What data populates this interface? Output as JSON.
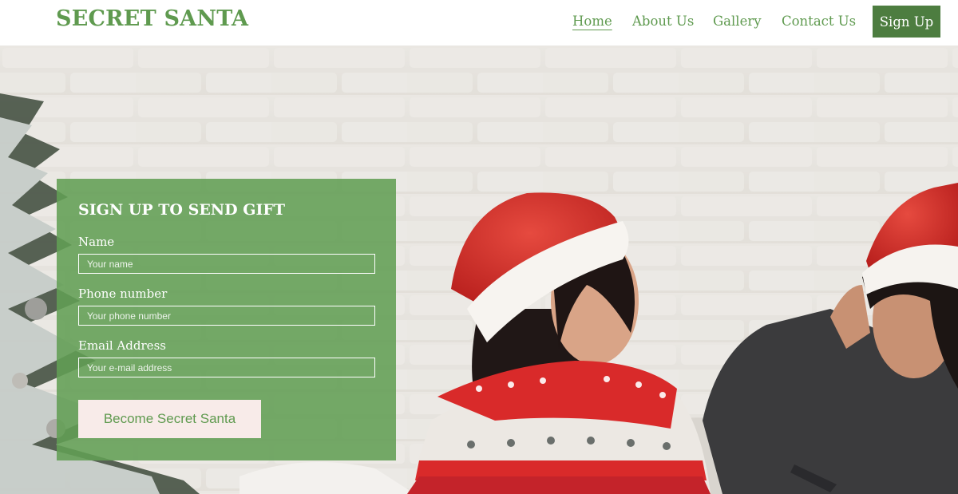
{
  "header": {
    "logo": "SECRET SANTA",
    "nav": [
      {
        "label": "Home"
      },
      {
        "label": "About Us"
      },
      {
        "label": "Gallery"
      },
      {
        "label": "Contact Us"
      }
    ],
    "signup_label": "Sign Up"
  },
  "form": {
    "title": "SIGN UP TO SEND GIFT",
    "name_label": "Name",
    "name_placeholder": "Your name",
    "phone_label": "Phone number",
    "phone_placeholder": "Your phone number",
    "email_label": "Email Address",
    "email_placeholder": "Your e-mail address",
    "submit_label": "Become Secret Santa"
  },
  "colors": {
    "brand_green": "#5f9a4f",
    "signup_button": "#4d7d40",
    "panel_green": "#629e54",
    "submit_button_bg": "#f8ebe9"
  }
}
